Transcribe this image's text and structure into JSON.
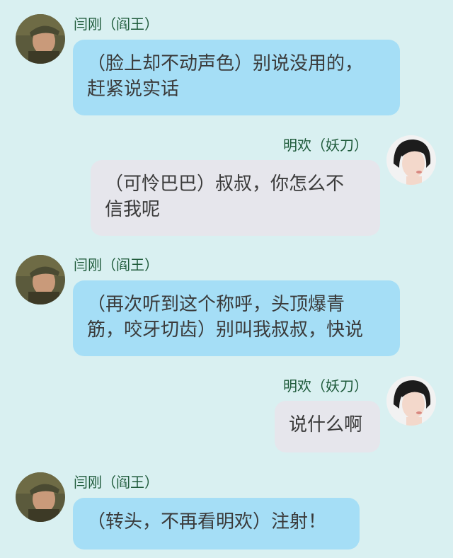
{
  "messages": [
    {
      "sender": "闫刚（阎王）",
      "side": "left",
      "avatar": "man-avatar",
      "lines": [
        "（脸上却不动声色）别说没用的，",
        "赶紧说实话"
      ]
    },
    {
      "sender": "明欢（妖刀）",
      "side": "right",
      "avatar": "woman-avatar",
      "lines": [
        "（可怜巴巴）叔叔，你怎么不",
        "信我呢"
      ]
    },
    {
      "sender": "闫刚（阎王）",
      "side": "left",
      "avatar": "man-avatar",
      "lines": [
        "（再次听到这个称呼，头顶爆青",
        "筋，咬牙切齿）别叫我叔叔，快说"
      ]
    },
    {
      "sender": "明欢（妖刀）",
      "side": "right",
      "avatar": "woman-avatar",
      "lines": [
        "说什么啊"
      ]
    },
    {
      "sender": "闫刚（阎王）",
      "side": "left",
      "avatar": "man-avatar",
      "lines": [
        "（转头，不再看明欢）注射！"
      ]
    }
  ],
  "colors": {
    "background": "#d9f0f1",
    "left_bubble": "#a5def6",
    "right_bubble": "#e6e6ec",
    "name_text": "#1e5a3a"
  }
}
